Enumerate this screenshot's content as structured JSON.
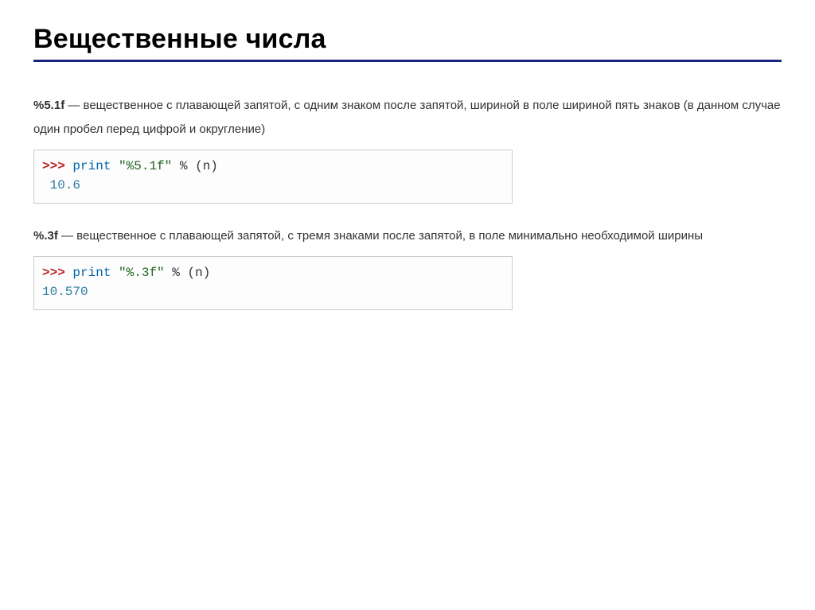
{
  "title": "Вещественные числа",
  "section1": {
    "format_code": "%5.1f",
    "desc": " — вещественное с плавающей запятой, с одним знаком после запятой, шириной в поле шириной пять знаков (в данном случае один пробел перед цифрой и округление)",
    "code": {
      "prompt": ">>> ",
      "kw": "print",
      "space1": " ",
      "str": "\"%5.1f\"",
      "space2": " ",
      "op1": "%",
      "space3": " ",
      "op2_open": "(",
      "var": "n",
      "op2_close": ")",
      "output": " 10.6"
    }
  },
  "section2": {
    "format_code": "%.3f",
    "desc": " — вещественное с плавающей запятой, с тремя знаками после запятой, в поле минимально необходимой ширины",
    "code": {
      "prompt": ">>> ",
      "kw": "print",
      "space1": " ",
      "str": "\"%.3f\"",
      "space2": " ",
      "op1": "%",
      "space3": " ",
      "op2_open": "(",
      "var": "n",
      "op2_close": ")",
      "output": "10.570"
    }
  }
}
